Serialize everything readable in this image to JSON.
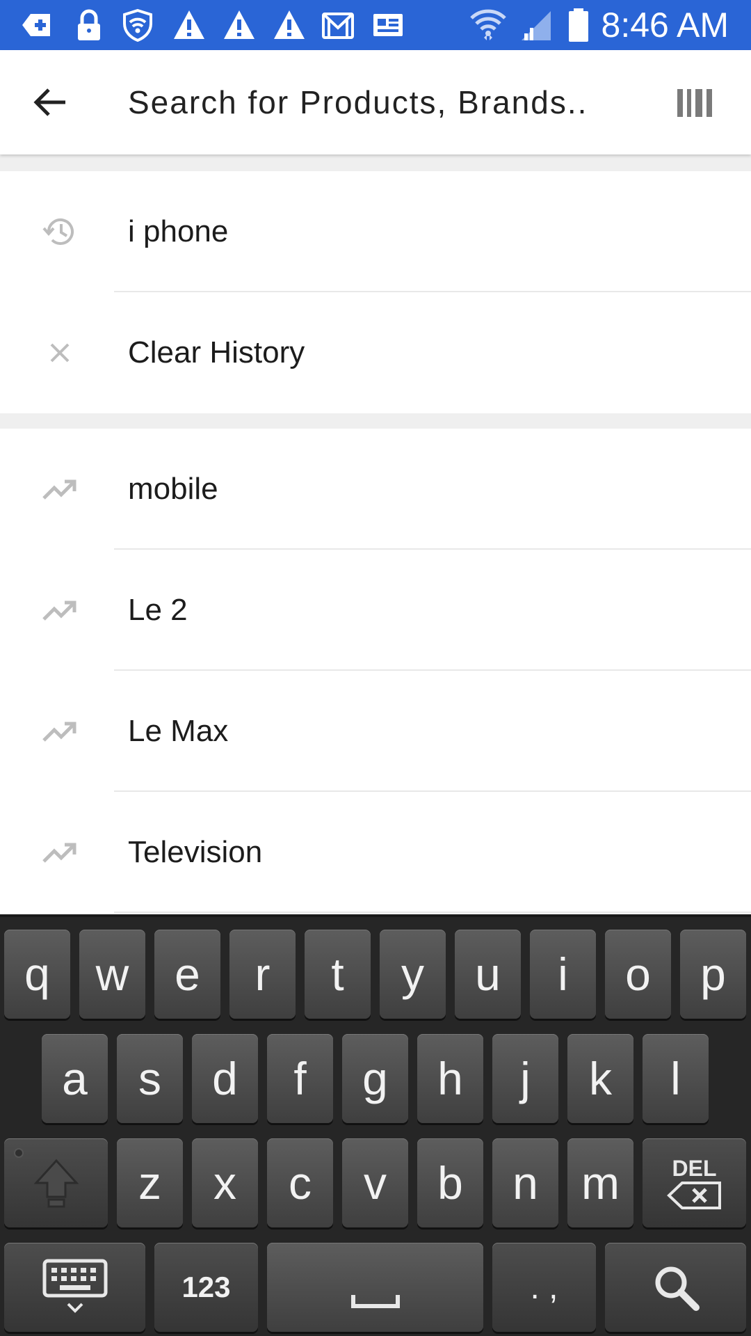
{
  "status_bar": {
    "time": "8:46 AM",
    "background_color": "#2a65d6",
    "left_icons": [
      "add-notification-icon",
      "lock-icon",
      "shield-wifi-icon",
      "warning-icon",
      "warning-icon",
      "warning-icon",
      "gmail-icon",
      "news-icon"
    ],
    "right_icons": [
      "wifi-icon",
      "cellular-signal-icon",
      "battery-icon"
    ]
  },
  "header": {
    "back_icon": "arrow-back-icon",
    "search_placeholder": "Search for Products, Brands..",
    "barcode_icon": "barcode-icon"
  },
  "history": {
    "items": [
      {
        "label": "i phone",
        "icon": "history-icon"
      },
      {
        "label": "Clear History",
        "icon": "close-icon"
      }
    ]
  },
  "trending": {
    "items": [
      {
        "label": "mobile",
        "icon": "trending-up-icon"
      },
      {
        "label": "Le 2",
        "icon": "trending-up-icon"
      },
      {
        "label": "Le Max",
        "icon": "trending-up-icon"
      },
      {
        "label": "Television",
        "icon": "trending-up-icon"
      }
    ]
  },
  "keyboard": {
    "row1": [
      "q",
      "w",
      "e",
      "r",
      "t",
      "y",
      "u",
      "i",
      "o",
      "p"
    ],
    "row2": [
      "a",
      "s",
      "d",
      "f",
      "g",
      "h",
      "j",
      "k",
      "l"
    ],
    "row3": [
      "z",
      "x",
      "c",
      "v",
      "b",
      "n",
      "m"
    ],
    "del_label": "DEL",
    "numbers_label": "123",
    "punct_label": ". ,",
    "icons": [
      "shift-icon",
      "backspace-icon",
      "keyboard-hide-icon",
      "space-icon",
      "search-icon"
    ]
  },
  "colors": {
    "accent": "#2a65d6",
    "list_icon": "#bdbdbd",
    "keyboard_bg": "#262626"
  }
}
